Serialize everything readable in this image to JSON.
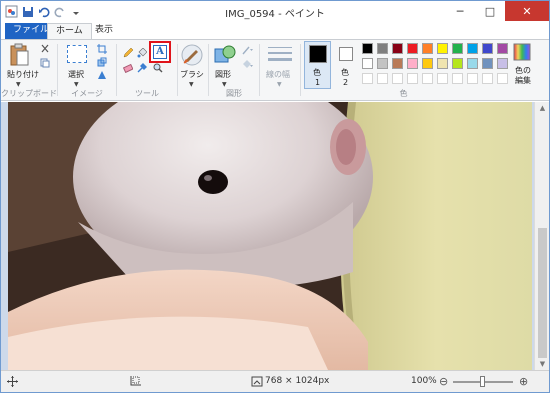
{
  "window": {
    "title": "IMG_0594 - ペイント",
    "controls": {
      "minimize": "─",
      "maximize": "□",
      "close": "✕"
    }
  },
  "tabs": [
    {
      "label": "ファイル",
      "active": false
    },
    {
      "label": "ホーム",
      "active": true
    },
    {
      "label": "表示",
      "active": false
    }
  ],
  "ribbon": {
    "clipboard": {
      "paste_label": "貼り付け",
      "group_label": "クリップボード"
    },
    "image": {
      "select_label": "選択",
      "group_label": "イメージ"
    },
    "tools": {
      "group_label": "ツール",
      "selected_tool": "text-tool"
    },
    "brushes": {
      "label": "ブラシ"
    },
    "shapes": {
      "label": "図形",
      "group_label": "図形"
    },
    "size": {
      "label": "線の幅"
    },
    "colors": {
      "color1_label": "色",
      "color1_num": "1",
      "color2_label": "色",
      "color2_num": "2",
      "group_label": "色",
      "edit_label": "色の編集",
      "color1_value": "#000000",
      "color2_value": "#ffffff",
      "palette_row1": [
        "#000000",
        "#7f7f7f",
        "#880015",
        "#ed1c24",
        "#ff7f27",
        "#fff200",
        "#22b14c",
        "#00a2e8",
        "#3f48cc",
        "#a349a4"
      ],
      "palette_row2": [
        "#ffffff",
        "#c3c3c3",
        "#b97a57",
        "#ffaec9",
        "#ffc90e",
        "#efe4b0",
        "#b5e61d",
        "#99d9ea",
        "#7092be",
        "#c8bfe7"
      ]
    }
  },
  "status": {
    "image_size": "768 × 1024px",
    "zoom": "100%",
    "zoom_level": 0.5
  }
}
